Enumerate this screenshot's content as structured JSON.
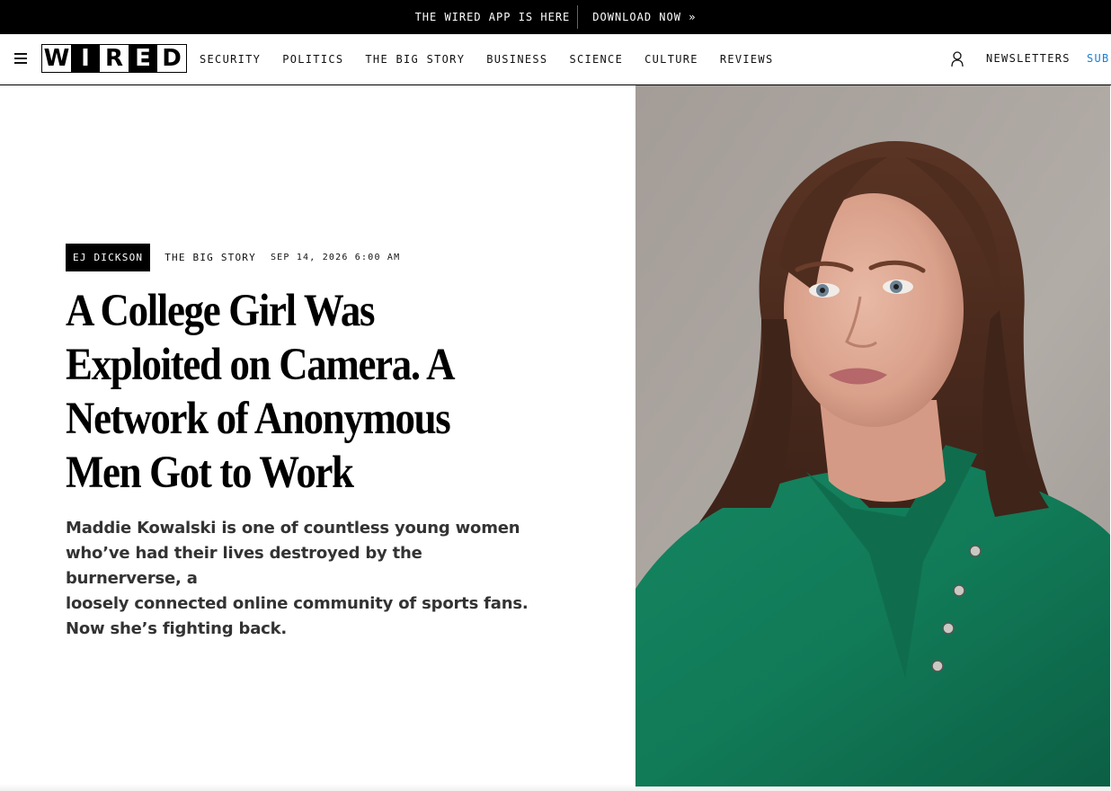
{
  "promo": {
    "text": "THE WIRED APP IS HERE",
    "link": "DOWNLOAD NOW »"
  },
  "nav": {
    "logo_letters": [
      "W",
      "I",
      "R",
      "E",
      "D"
    ],
    "links": [
      "SECURITY",
      "POLITICS",
      "THE BIG STORY",
      "BUSINESS",
      "SCIENCE",
      "CULTURE",
      "REVIEWS"
    ],
    "newsletters": "NEWSLETTERS",
    "subscribe": "SUB"
  },
  "article": {
    "byline": "EJ DICKSON",
    "rubric": "THE BIG STORY",
    "date": "SEP 14, 2026 6:00 AM",
    "headline_lines": [
      "A College Girl Was",
      "Exploited on Camera. A",
      "Network of Anonymous",
      "Men Got to Work"
    ],
    "dek_lines": [
      "Maddie Kowalski is one of countless young women",
      "who’ve had their lives destroyed by the burnerverse, a",
      "loosely connected online community of sports fans.",
      "Now she’s fighting back."
    ]
  },
  "colors": {
    "promo_bg": "#000000",
    "subscribe": "#1a7fd4",
    "sweater": "#117a57",
    "background_wall": "#a9a29d"
  }
}
